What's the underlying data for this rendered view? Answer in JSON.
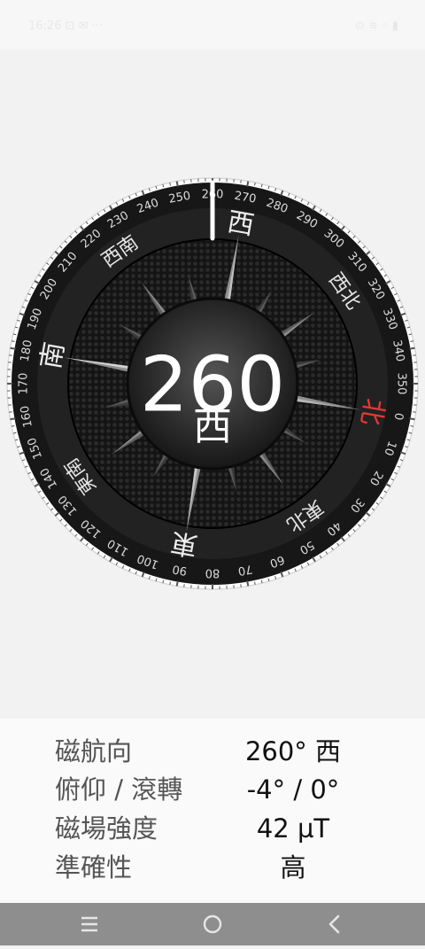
{
  "status_bar": {
    "time": "16:26",
    "left_icons": "⊡ ✉ ···",
    "right_icons": "⊙ ≋ ◦ ▮"
  },
  "compass": {
    "heading_degrees": 260,
    "heading_value": "260",
    "heading_direction": "西",
    "north_label": "北",
    "cardinal_labels": [
      "北",
      "東",
      "南",
      "西"
    ],
    "intercardinal_labels": [
      "東北",
      "東南",
      "西南",
      "西北"
    ],
    "tick_labels": [
      "0",
      "10",
      "20",
      "30",
      "40",
      "50",
      "60",
      "70",
      "80",
      "90",
      "100",
      "110",
      "120",
      "130",
      "140",
      "150",
      "160",
      "170",
      "180",
      "190",
      "200",
      "210",
      "220",
      "230",
      "240",
      "250",
      "260",
      "270",
      "280",
      "290",
      "300",
      "310",
      "320",
      "330",
      "340",
      "350"
    ],
    "colors": {
      "north": "#e53935",
      "ring": "#161616",
      "dial": "#2a2a2a",
      "text": "#dddddd"
    }
  },
  "info": {
    "rows": [
      {
        "label": "磁航向",
        "value": "260° 西"
      },
      {
        "label": "俯仰 / 滾轉",
        "value": "-4° / 0°"
      },
      {
        "label": "磁場強度",
        "value": "42 µT"
      },
      {
        "label": "準確性",
        "value": "高"
      }
    ]
  },
  "nav_bar": {
    "buttons": [
      "recent-apps",
      "home",
      "back"
    ]
  }
}
